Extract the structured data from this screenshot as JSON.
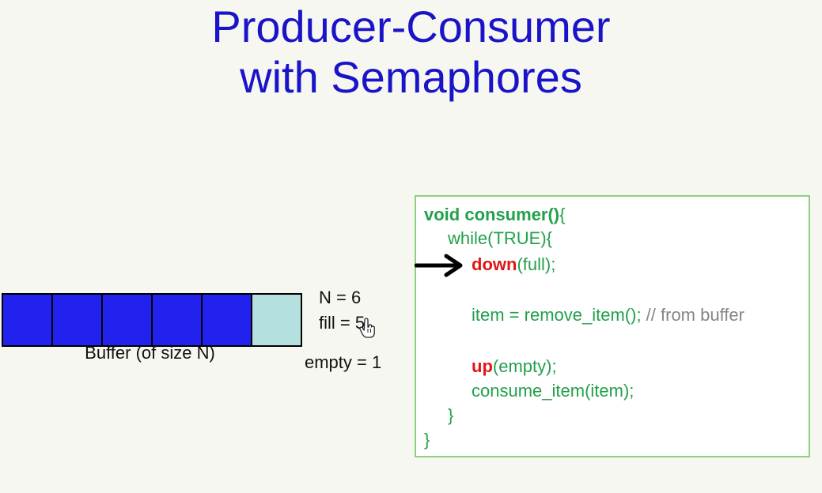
{
  "title": {
    "line1": "Producer-Consumer",
    "line2": "with Semaphores"
  },
  "buffer": {
    "size": 6,
    "filled_count": 5,
    "caption": "Buffer (of size N)",
    "colors": {
      "filled": "#2222ee",
      "empty": "#b5e0e0"
    }
  },
  "state": {
    "n": "N = 6",
    "fill": "fill = 5",
    "empty": "empty = 1"
  },
  "code": {
    "func_name": "void consumer()",
    "func_open_brace": "{",
    "while_line": "while(TRUE){",
    "down_kw": "down",
    "down_arg": "(full);",
    "item_stmt": "item = remove_item();",
    "item_comment": " // from buffer",
    "up_kw": "up",
    "up_arg": "(empty);",
    "consume_stmt": "consume_item(item);",
    "close_while": "}",
    "close_func": "}"
  },
  "icons": {
    "pointer": "arrow-right-icon",
    "cursor": "hand-cursor-icon"
  },
  "colors": {
    "title": "#1a14c8",
    "code_text": "#22a04a",
    "keyword_red": "#e01616",
    "comment": "#858585",
    "code_border": "#8fd07e"
  }
}
